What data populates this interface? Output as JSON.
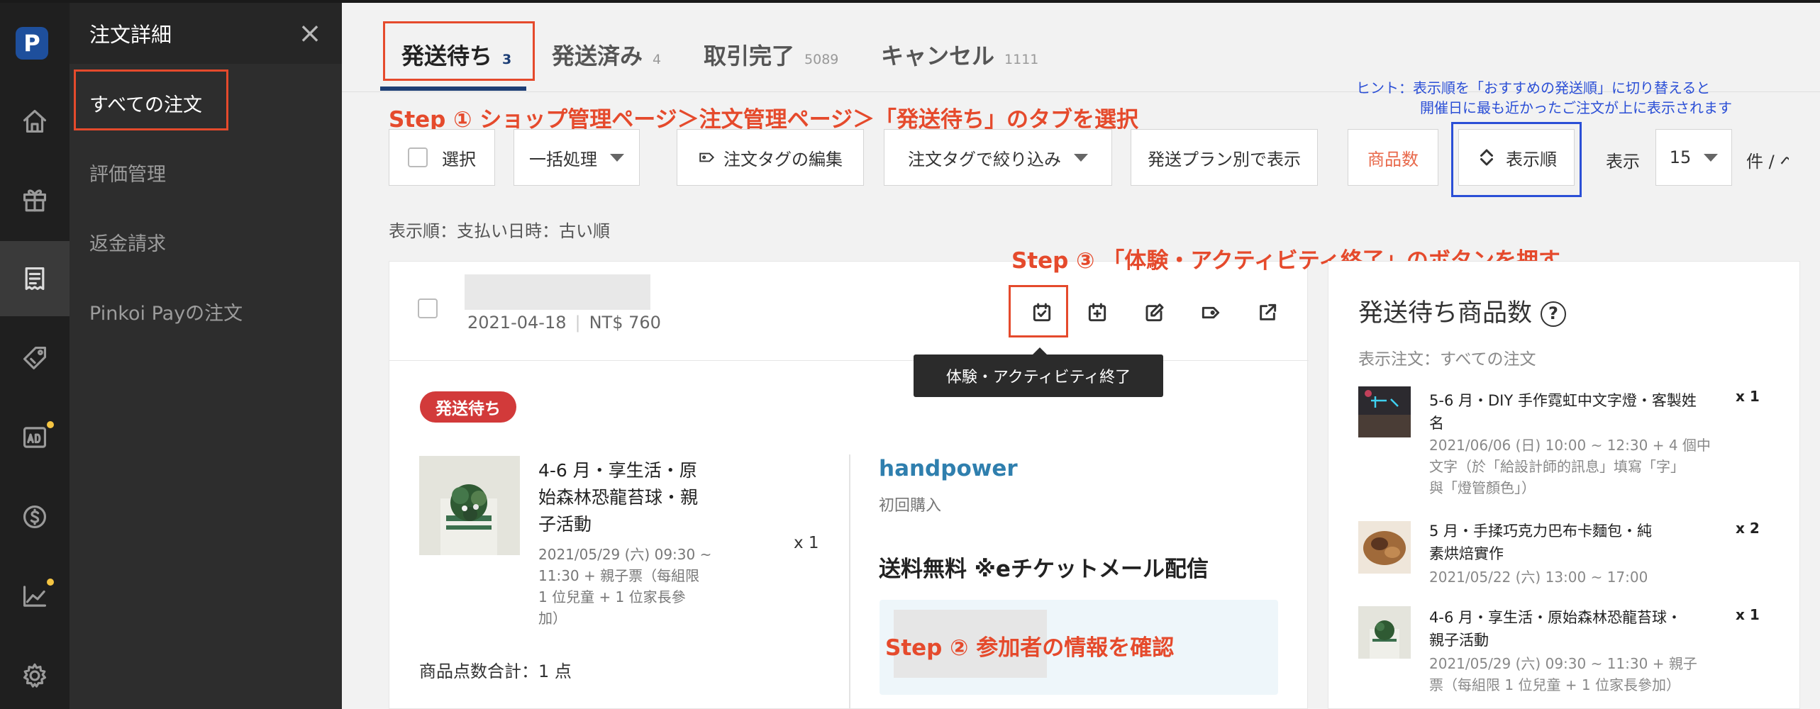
{
  "app": {
    "logo_letter": "P",
    "accent": "#1d3e75",
    "annotation_red": "#e54a2c",
    "annotation_blue": "#2b4fd6"
  },
  "rail": {
    "icons": [
      "home-icon",
      "gift-icon",
      "orders-icon",
      "tag-icon",
      "ad-icon",
      "dollar-icon",
      "chart-icon",
      "settings-icon"
    ]
  },
  "submenu": {
    "title": "注文詳細",
    "close": "×",
    "items": [
      {
        "label": "すべての注文"
      },
      {
        "label": "評価管理"
      },
      {
        "label": "返金請求"
      },
      {
        "label": "Pinkoi Payの注文"
      }
    ]
  },
  "tabs": [
    {
      "label": "発送待ち",
      "count": "3"
    },
    {
      "label": "発送済み",
      "count": "4"
    },
    {
      "label": "取引完了",
      "count": "5089"
    },
    {
      "label": "キャンセル",
      "count": "1111"
    }
  ],
  "annotations": {
    "step1": "Step ① ショップ管理ページ＞注文管理ページ＞「発送待ち」のタブを選択",
    "step2": "Step ② 参加者の情報を確認",
    "step3": "Step ③ 「体験・アクティビティ終了」のボタンを押す",
    "hint_line1": "ヒント：表示順を「おすすめの発送順」に切り替えると",
    "hint_line2": "開催日に最も近かったご注文が上に表示されます"
  },
  "toolbar": {
    "select": "選択",
    "bulk": "一括処理",
    "edit_tags": "注文タグの編集",
    "filter_tags": "注文タグで絞り込み",
    "by_plan": "発送プラン別で表示",
    "item_count": "商品数",
    "sort": "表示順",
    "show_label": "表示",
    "per_page": "15",
    "per_page_unit": "件 / ペ"
  },
  "sort_status": "表示順：支払い日時：古い順",
  "order": {
    "date": "2021-04-18",
    "amount": "NT$ 760",
    "tooltip": "体験・アクティビティ終了",
    "status_badge": "発送待ち",
    "product": {
      "title_lines": [
        "4-6 月・享生活・原",
        "始森林恐龍苔球・親",
        "子活動"
      ],
      "detail_lines": [
        "2021/05/29 (六) 09:30 ~",
        "11:30 + 親子票（每組限",
        "1 位兒童 + 1 位家長參",
        "加）"
      ],
      "qty": "x 1"
    },
    "total_items": "商品点数合計：1 点",
    "buyer": "handpower",
    "buyer_note": "初回購入",
    "shipping": "送料無料 ※eチケットメール配信"
  },
  "panel": {
    "title": "発送待ち商品数",
    "help": "?",
    "subtitle": "表示注文：すべての注文",
    "items": [
      {
        "title_lines": [
          "5-6 月・DIY 手作霓虹中文字燈・客製姓",
          "名"
        ],
        "detail_lines": [
          "2021/06/06 (日) 10:00 ~ 12:30 + 4 個中",
          "文字（於「給設計師的訊息」填寫「字」",
          "與「燈管顏色」）"
        ],
        "qty": "x 1"
      },
      {
        "title_lines": [
          "5 月・手揉巧克力巴布卡麵包・純",
          "素烘焙實作"
        ],
        "detail_lines": [
          "2021/05/22 (六) 13:00 ~ 17:00"
        ],
        "qty": "x 2"
      },
      {
        "title_lines": [
          "4-6 月・享生活・原始森林恐龍苔球・",
          "親子活動"
        ],
        "detail_lines": [
          "2021/05/29 (六) 09:30 ~ 11:30 + 親子",
          "票（每組限 1 位兒童 + 1 位家長參加）"
        ],
        "qty": "x 1"
      }
    ]
  }
}
